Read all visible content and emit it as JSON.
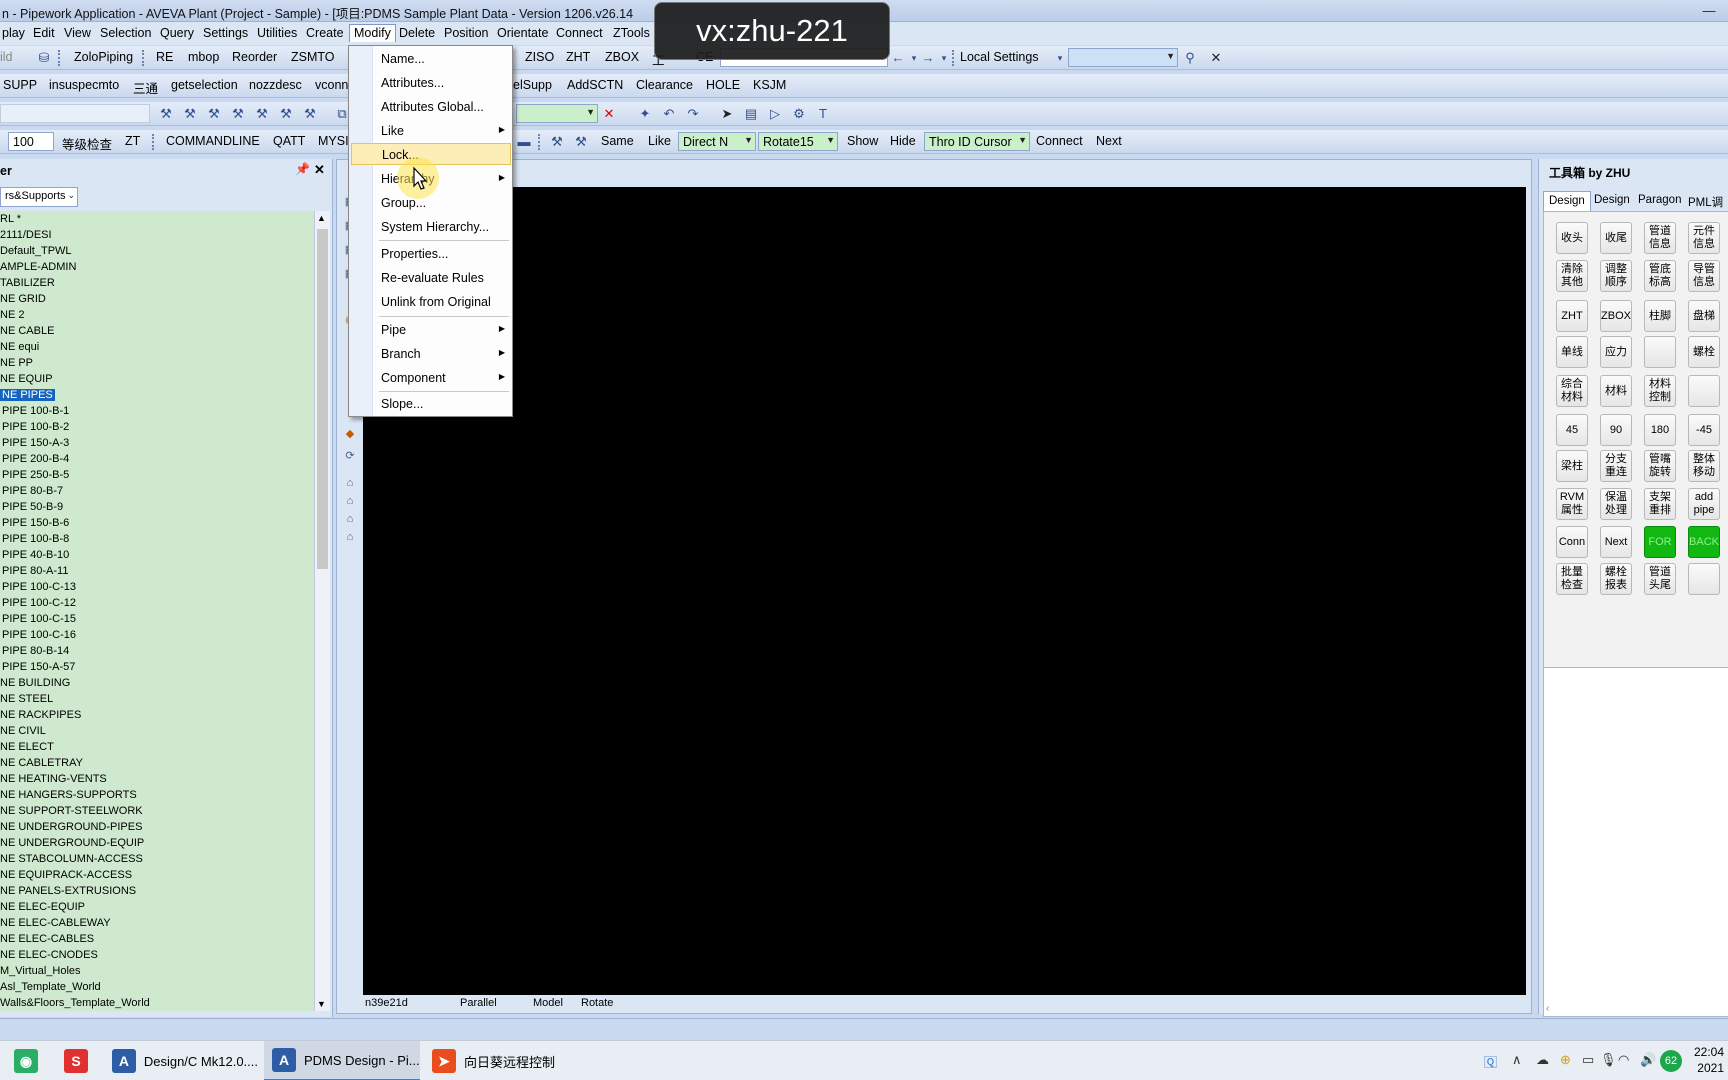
{
  "window": {
    "title": "n - Pipework Application - AVEVA Plant (Project - Sample) - [项目:PDMS Sample Plant Data - Version 1206.v26.14",
    "minimize": "—"
  },
  "watermark": "vx:zhu-221",
  "menubar": [
    "play",
    "Edit",
    "View",
    "Selection",
    "Query",
    "Settings",
    "Utilities",
    "Create",
    "Modify",
    "Delete",
    "Position",
    "Orientate",
    "Connect",
    "ZTools",
    "工"
  ],
  "toolbar1": {
    "items": [
      "ild",
      "ZoloPiping",
      "RE",
      "mbop",
      "Reorder",
      "ZSMTO",
      "ZISO",
      "ZHT",
      "ZBOX",
      "工",
      "CE"
    ],
    "local_settings": "Local Settings"
  },
  "toolbar2": {
    "items": [
      "SUPP",
      "insuspecmto",
      "三通",
      "getselection",
      "nozzdesc",
      "vconn",
      "elSupp",
      "AddSCTN",
      "Clearance",
      "HOLE",
      "KSJM"
    ]
  },
  "toolbar4": {
    "zoom": "100",
    "items": [
      "等级检查",
      "ZT",
      "COMMANDLINE",
      "QATT",
      "MYSI",
      "Same",
      "Like",
      "Show",
      "Hide",
      "Connect",
      "Next"
    ],
    "direct": "Direct N",
    "rotate": "Rotate15",
    "thro": "Thro ID Cursor"
  },
  "explorer": {
    "title": "er",
    "filter": "rs&Supports",
    "items": [
      "RL *",
      "2111/DESI",
      "Default_TPWL",
      "AMPLE-ADMIN",
      "TABILIZER",
      "NE GRID",
      "NE 2",
      "NE CABLE",
      "NE equi",
      "NE PP",
      "NE EQUIP",
      "NE PIPES",
      "PIPE 100-B-1",
      "PIPE 100-B-2",
      "PIPE 150-A-3",
      "PIPE 200-B-4",
      "PIPE 250-B-5",
      "PIPE 80-B-7",
      "PIPE 50-B-9",
      "PIPE 150-B-6",
      "PIPE 100-B-8",
      "PIPE 40-B-10",
      "PIPE 80-A-11",
      "PIPE 100-C-13",
      "PIPE 100-C-12",
      "PIPE 100-C-15",
      "PIPE 100-C-16",
      "PIPE 80-B-14",
      "PIPE 150-A-57",
      "NE BUILDING",
      "NE STEEL",
      "NE RACKPIPES",
      "NE CIVIL",
      "NE ELECT",
      "NE CABLETRAY",
      "NE HEATING-VENTS",
      "NE HANGERS-SUPPORTS",
      "NE SUPPORT-STEELWORK",
      "NE UNDERGROUND-PIPES",
      "NE UNDERGROUND-EQUIP",
      "NE STABCOLUMN-ACCESS",
      "NE EQUIPRACK-ACCESS",
      "NE PANELS-EXTRUSIONS",
      "NE ELEC-EQUIP",
      "NE ELEC-CABLEWAY",
      "NE ELEC-CABLES",
      "NE ELEC-CNODES",
      "M_Virtual_Holes",
      "Asl_Template_World",
      "Walls&Floors_Template_World"
    ],
    "selected_index": 11
  },
  "viewport": {
    "status": [
      "n39e21d",
      "Parallel",
      "Model",
      "Rotate"
    ]
  },
  "toolbox": {
    "title": "工具箱 by ZHU",
    "tabs": [
      "Design",
      "Design",
      "Paragon",
      "PML调"
    ],
    "buttons": [
      "收头",
      "收尾",
      "管道\n信息",
      "元件\n信息",
      "清除\n其他",
      "调整\n顺序",
      "管底\n标高",
      "导管\n信息",
      "ZHT",
      "ZBOX",
      "柱脚",
      "盘梯",
      "单线",
      "应力",
      "",
      "螺栓",
      "综合\n材料",
      "材料",
      "材料\n控制",
      "",
      "45",
      "90",
      "180",
      "-45",
      "梁柱",
      "分支\n重连",
      "管嘴\n旋转",
      "整体\n移动",
      "RVM\n属性",
      "保温\n处理",
      "支架\n重排",
      "add\npipe",
      "Conn",
      "Next",
      "FOR",
      "BACK",
      "批量\n检查",
      "螺栓\n报表",
      "管道\n头尾",
      ""
    ]
  },
  "modify_menu": {
    "items": [
      "Name...",
      "Attributes...",
      "Attributes Global...",
      "Like",
      "Lock...",
      "Hierarchy",
      "Group...",
      "System Hierarchy...",
      "Properties...",
      "Re-evaluate Rules",
      "Unlink from Original",
      "Pipe",
      "Branch",
      "Component",
      "Slope..."
    ]
  },
  "taskbar": {
    "tasks": [
      "Design/C Mk12.0....",
      "PDMS Design - Pi...",
      "向日葵远程控制"
    ],
    "clock_time": "22:04",
    "clock_date": "2021",
    "battery": "62"
  }
}
